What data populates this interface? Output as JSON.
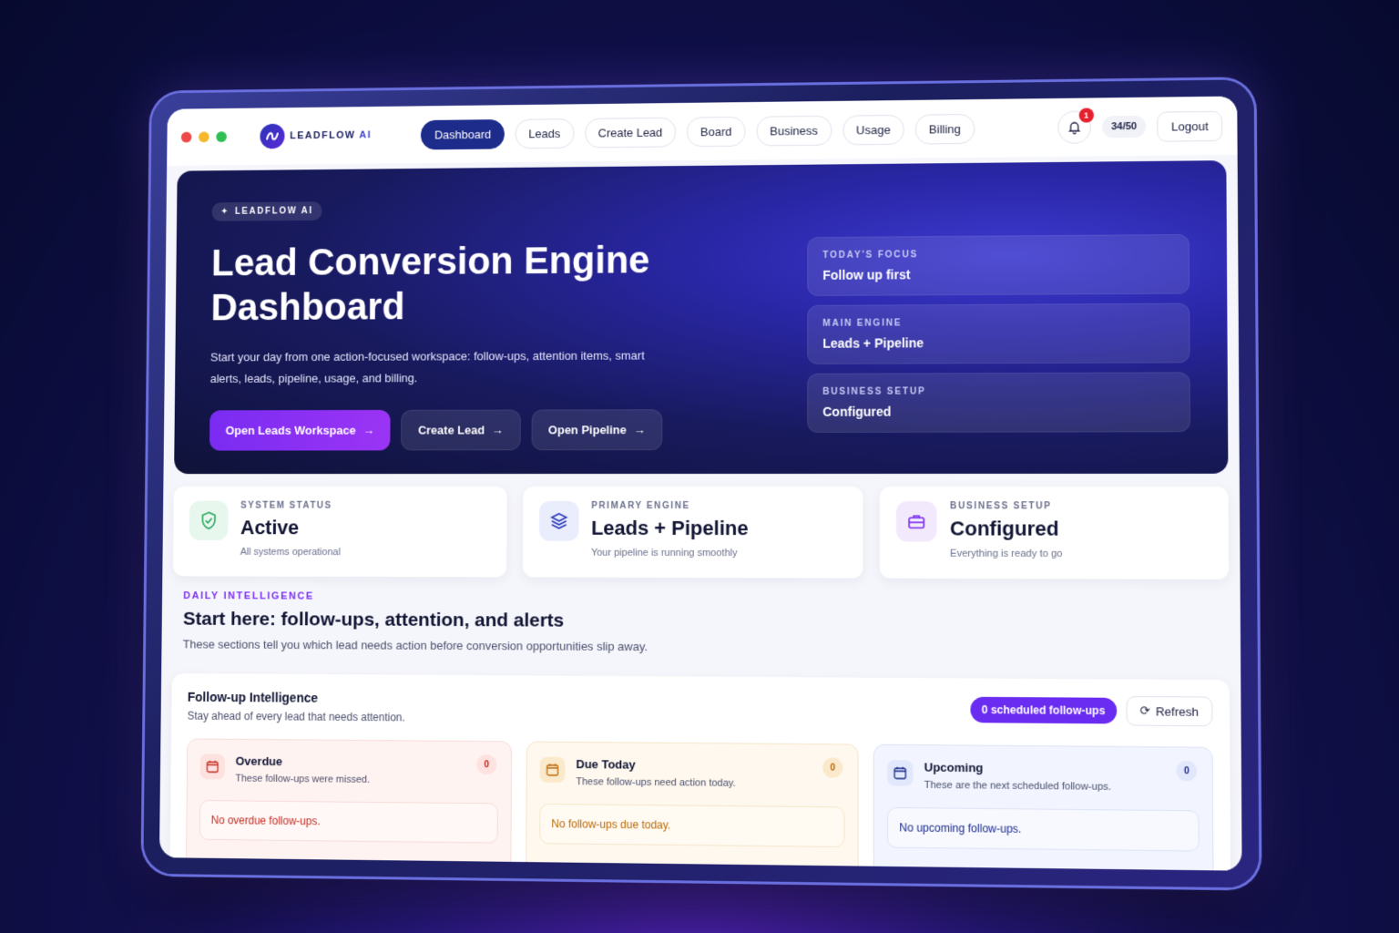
{
  "topbar": {
    "brand_main": "LEADFLOW",
    "brand_suffix": "AI",
    "nav": [
      {
        "label": "Dashboard",
        "active": true
      },
      {
        "label": "Leads"
      },
      {
        "label": "Create Lead"
      },
      {
        "label": "Board"
      },
      {
        "label": "Business"
      },
      {
        "label": "Usage"
      },
      {
        "label": "Billing"
      }
    ],
    "notification_count": "1",
    "usage": "34/50",
    "logout": "Logout"
  },
  "hero": {
    "tag": "LEADFLOW AI",
    "title": "Lead Conversion Engine Dashboard",
    "subtitle": "Start your day from one action-focused workspace: follow-ups, attention items, smart alerts, leads, pipeline, usage, and billing.",
    "actions": [
      {
        "label": "Open Leads Workspace"
      },
      {
        "label": "Create Lead"
      },
      {
        "label": "Open Pipeline"
      }
    ],
    "focus": [
      {
        "label": "TODAY'S FOCUS",
        "value": "Follow up first"
      },
      {
        "label": "MAIN ENGINE",
        "value": "Leads + Pipeline"
      },
      {
        "label": "BUSINESS SETUP",
        "value": "Configured"
      }
    ]
  },
  "status": [
    {
      "label": "SYSTEM STATUS",
      "value": "Active",
      "desc": "All systems operational",
      "icon": "shield-check-icon"
    },
    {
      "label": "PRIMARY ENGINE",
      "value": "Leads + Pipeline",
      "desc": "Your pipeline is running smoothly",
      "icon": "layers-icon"
    },
    {
      "label": "BUSINESS SETUP",
      "value": "Configured",
      "desc": "Everything is ready to go",
      "icon": "briefcase-icon"
    }
  ],
  "intel": {
    "eyebrow": "DAILY INTELLIGENCE",
    "title": "Start here: follow-ups, attention, and alerts",
    "subtitle": "These sections tell you which lead needs action before conversion opportunities slip away."
  },
  "followup": {
    "title": "Follow-up Intelligence",
    "subtitle": "Stay ahead of every lead that needs attention.",
    "scheduled": "0 scheduled follow-ups",
    "refresh": "Refresh",
    "cards": [
      {
        "title": "Overdue",
        "desc": "These follow-ups were missed.",
        "count": "0",
        "empty": "No overdue follow-ups."
      },
      {
        "title": "Due Today",
        "desc": "These follow-ups need action today.",
        "count": "0",
        "empty": "No follow-ups due today."
      },
      {
        "title": "Upcoming",
        "desc": "These are the next scheduled follow-ups.",
        "count": "0",
        "empty": "No upcoming follow-ups."
      }
    ]
  },
  "colors": {
    "accent": "#7a2cf2",
    "nav_active": "#1d2b8a",
    "danger": "#e5202e"
  }
}
